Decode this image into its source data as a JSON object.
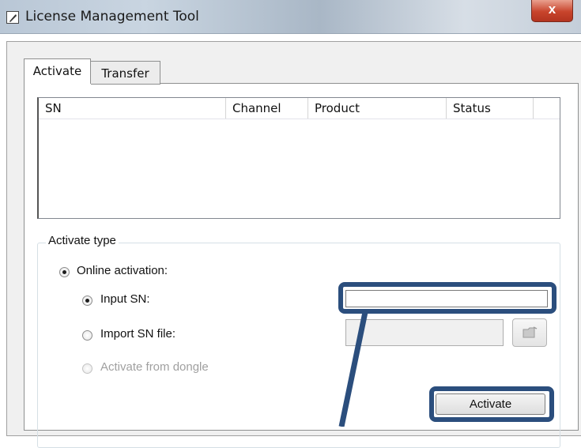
{
  "window": {
    "title": "License Management Tool",
    "close_symbol": "x"
  },
  "tabs": [
    {
      "label": "Activate",
      "selected": true
    },
    {
      "label": "Transfer",
      "selected": false
    }
  ],
  "list": {
    "columns": [
      "SN",
      "Channel",
      "Product",
      "Status"
    ],
    "rows": []
  },
  "activate_type": {
    "legend": "Activate type",
    "online_activation": {
      "label": "Online activation:",
      "checked": true
    },
    "input_sn": {
      "label": "Input SN:",
      "checked": true,
      "value": ""
    },
    "import_sn_file": {
      "label": "Import SN file:",
      "checked": false,
      "value": ""
    },
    "activate_from_dongle": {
      "label": "Activate from dongle",
      "checked": false,
      "disabled": true
    }
  },
  "buttons": {
    "activate": "Activate"
  },
  "icons": {
    "app": "wrench-icon",
    "close": "close-icon",
    "browse": "folder-icon"
  },
  "colors": {
    "highlight": "#2b4e7d",
    "close_button": "#c8442c"
  }
}
